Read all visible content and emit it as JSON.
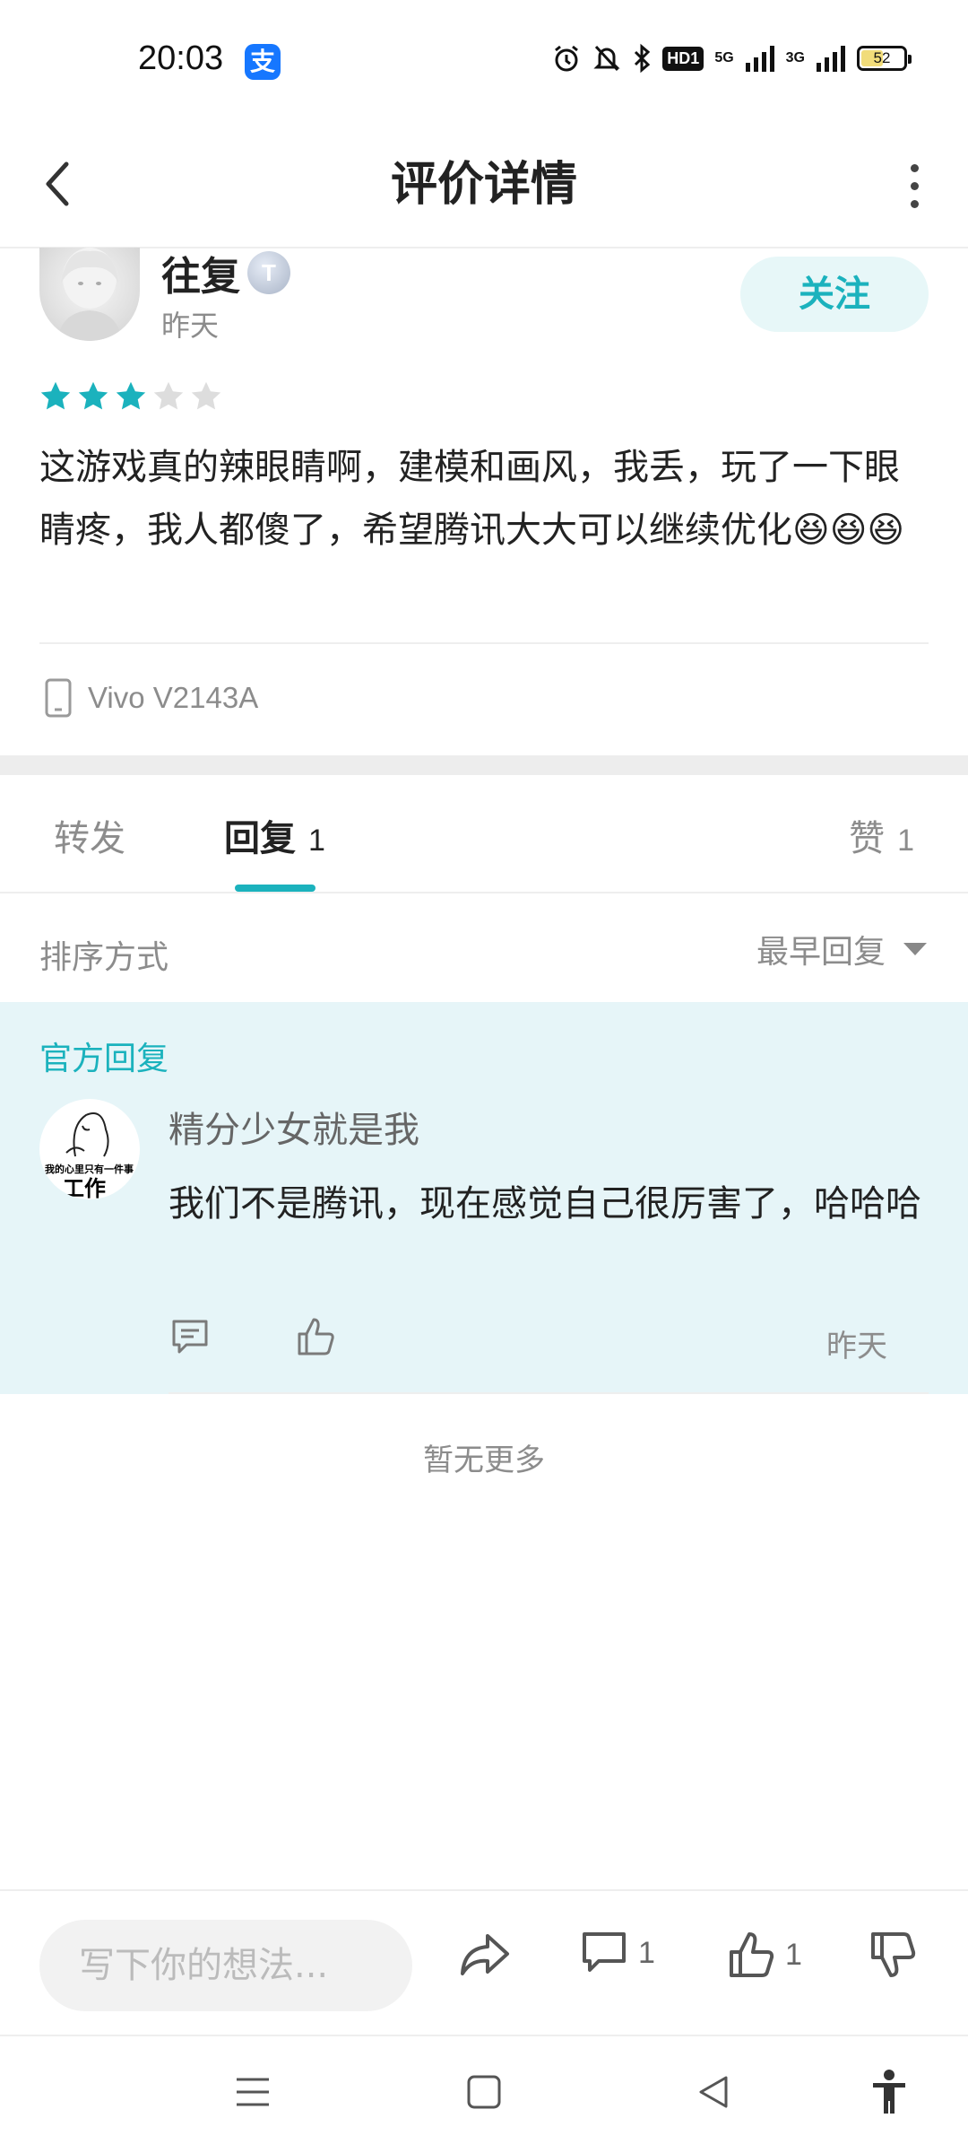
{
  "status_bar": {
    "time": "20:03",
    "alipay_icon": "支",
    "hd_label": "HD1",
    "network_1": "5G",
    "network_2": "3G",
    "battery": "52",
    "battery_level_percent": 52
  },
  "header": {
    "title": "评价详情"
  },
  "review": {
    "username": "往复",
    "level_badge": "T",
    "time": "昨天",
    "follow_label": "关注",
    "rating": 3,
    "rating_max": 5,
    "text": "这游戏真的辣眼睛啊，建模和画风，我丢，玩了一下眼睛疼，我人都傻了，希望腾讯大大可以继续优化😆😆😆",
    "device": "Vivo V2143A"
  },
  "tabs": {
    "forward_label": "转发",
    "reply_label": "回复",
    "reply_count": "1",
    "like_label": "赞",
    "like_count": "1"
  },
  "sort": {
    "label": "排序方式",
    "selected": "最早回复"
  },
  "official_reply": {
    "label": "官方回复",
    "avatar_line1": "我的心里只有一件事",
    "avatar_line2": "工作",
    "author": "精分少女就是我",
    "text": "我们不是腾讯，现在感觉自己很厉害了，哈哈哈",
    "time": "昨天"
  },
  "no_more": "暂无更多",
  "action_bar": {
    "input_placeholder": "写下你的想法...",
    "comment_count": "1",
    "like_count": "1"
  },
  "colors": {
    "accent": "#1bb2bd",
    "official_bg": "#e6f5f8",
    "star_filled": "#1bb2bd",
    "star_empty": "#dddddd"
  },
  "icons": [
    "back-arrow-icon",
    "more-icon",
    "phone-icon",
    "chevron-down-icon",
    "comment-icon",
    "like-icon",
    "share-icon",
    "dislike-icon",
    "menu-icon",
    "home-icon",
    "nav-back-icon",
    "accessibility-icon"
  ]
}
